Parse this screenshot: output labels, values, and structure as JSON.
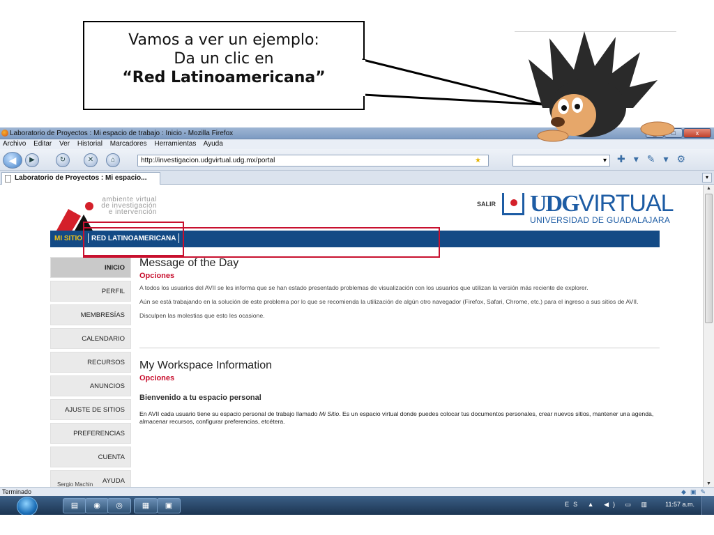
{
  "callout": {
    "line1": "Vamos a ver un ejemplo:",
    "line2": "Da un clic en",
    "line3": "“Red Latinoamericana”"
  },
  "window": {
    "title": "Laboratorio de Proyectos : Mi espacio de trabajo : Inicio - Mozilla Firefox",
    "minimize": "_",
    "maximize": "□",
    "close": "x"
  },
  "menu": [
    "Archivo",
    "Editar",
    "Ver",
    "Historial",
    "Marcadores",
    "Herramientas",
    "Ayuda"
  ],
  "browser": {
    "url": "http://investigacion.udgvirtual.udg.mx/portal",
    "search_placeholder": "",
    "tab_title": "Laboratorio de Proyectos : Mi espacio..."
  },
  "header": {
    "logo_line1": "ambiente virtual",
    "logo_line2": "de investigación",
    "logo_line3": "e intervención",
    "salir": "SALIR",
    "udg_bold": "UDG",
    "udg_light": "VIRTUAL",
    "udg_sub": "UNIVERSIDAD DE GUADALAJARA"
  },
  "topnav": {
    "mi_sitio": "MI SITIO",
    "red": "RED LATINOAMERICANA"
  },
  "sidebar": [
    {
      "label": "INICIO",
      "active": true
    },
    {
      "label": "PERFIL"
    },
    {
      "label": "MEMBRESÍAS"
    },
    {
      "label": "CALENDARIO"
    },
    {
      "label": "RECURSOS"
    },
    {
      "label": "ANUNCIOS"
    },
    {
      "label": "AJUSTE DE SITIOS"
    },
    {
      "label": "PREFERENCIAS"
    },
    {
      "label": "CUENTA"
    },
    {
      "label": "AYUDA"
    }
  ],
  "motd": {
    "title": "Message of the Day",
    "options": "Opciones",
    "p1": "A todos los usuarios del AVII se les informa que se han estado presentado problemas de visualización con los usuarios que utilizan la versión más reciente de explorer.",
    "p2": "Aún se está trabajando en la solución de este problema por lo que se recomienda la utilización de algún otro navegador (Firefox, Safari, Chrome, etc.) para el ingreso a sus sitios de AVII.",
    "p3": "Disculpen las molestias que esto les ocasione."
  },
  "workspace": {
    "title": "My Workspace Information",
    "options": "Opciones",
    "subtitle": "Bienvenido a tu espacio personal",
    "text_before": "En AVII cada usuario tiene su espacio personal de trabajo llamado ",
    "text_em": "Mi Sitio",
    "text_after": ". Es un espacio virtual donde puedes colocar tus documentos personales, crear nuevos sitios, mantener una agenda, almacenar recursos, configurar preferencias, etcétera."
  },
  "footer_user": "Sergio Machin",
  "status": "Terminado",
  "taskbar": {
    "lang": "ES",
    "time": "11:57 a.m."
  },
  "colors": {
    "udg_blue": "#1d5ca4",
    "nav_blue": "#134a85",
    "accent_red": "#c8102e",
    "mi_sitio_yellow": "#f2c318"
  }
}
